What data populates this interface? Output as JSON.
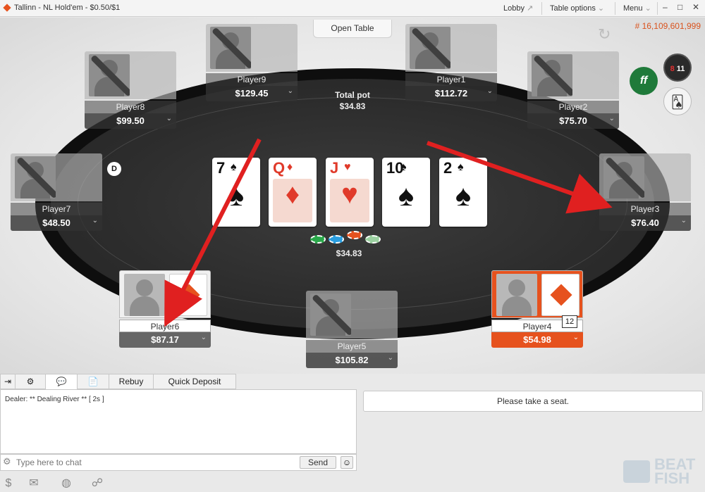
{
  "window": {
    "title": "Tallinn -  NL  Hold'em - $0.50/$1",
    "lobby_label": "Lobby",
    "table_options_label": "Table options",
    "menu_label": "Menu",
    "minimize": "–",
    "maximize": "□",
    "close": "✕"
  },
  "table": {
    "open_table_label": "Open Table",
    "hand_id": "# 16,109,601,999",
    "total_pot_label": "Total pot",
    "total_pot_value": "$34.83",
    "chips_value": "$34.83",
    "dealer_button": "D",
    "board_cards": [
      {
        "rank": "7",
        "suit": "♠",
        "color": "black"
      },
      {
        "rank": "Q",
        "suit": "♦",
        "color": "red"
      },
      {
        "rank": "J",
        "suit": "♥",
        "color": "red"
      },
      {
        "rank": "10",
        "suit": "♠",
        "color": "black"
      },
      {
        "rank": "2",
        "suit": "♠",
        "color": "black"
      }
    ]
  },
  "seats": {
    "player9": {
      "name": "Player9",
      "stack": "$129.45"
    },
    "player1": {
      "name": "Player1",
      "stack": "$112.72"
    },
    "player8": {
      "name": "Player8",
      "stack": "$99.50"
    },
    "player2": {
      "name": "Player2",
      "stack": "$75.70"
    },
    "player7": {
      "name": "Player7",
      "stack": "$48.50"
    },
    "player3": {
      "name": "Player3",
      "stack": "$76.40"
    },
    "player6": {
      "name": "Player6",
      "stack": "$87.17"
    },
    "player5": {
      "name": "Player5",
      "stack": "$105.82"
    },
    "player4": {
      "name": "Player4",
      "stack": "$54.98",
      "badge": "12"
    }
  },
  "side_icons": {
    "ff": "ff",
    "eight_ball": "8",
    "eleven": "11"
  },
  "bottom": {
    "tabs": {
      "rebuy": "Rebuy",
      "quick_deposit": "Quick Deposit"
    },
    "chat_log": "Dealer: ** Dealing River ** [ 2s ]",
    "chat_placeholder": "Type here to chat",
    "send_label": "Send",
    "status_message": "Please take a seat."
  },
  "watermark": {
    "line1": "BEAT",
    "line2": "FISH"
  },
  "colors": {
    "accent": "#e6521e",
    "arrow": "#e02020",
    "felt": "#333333"
  }
}
